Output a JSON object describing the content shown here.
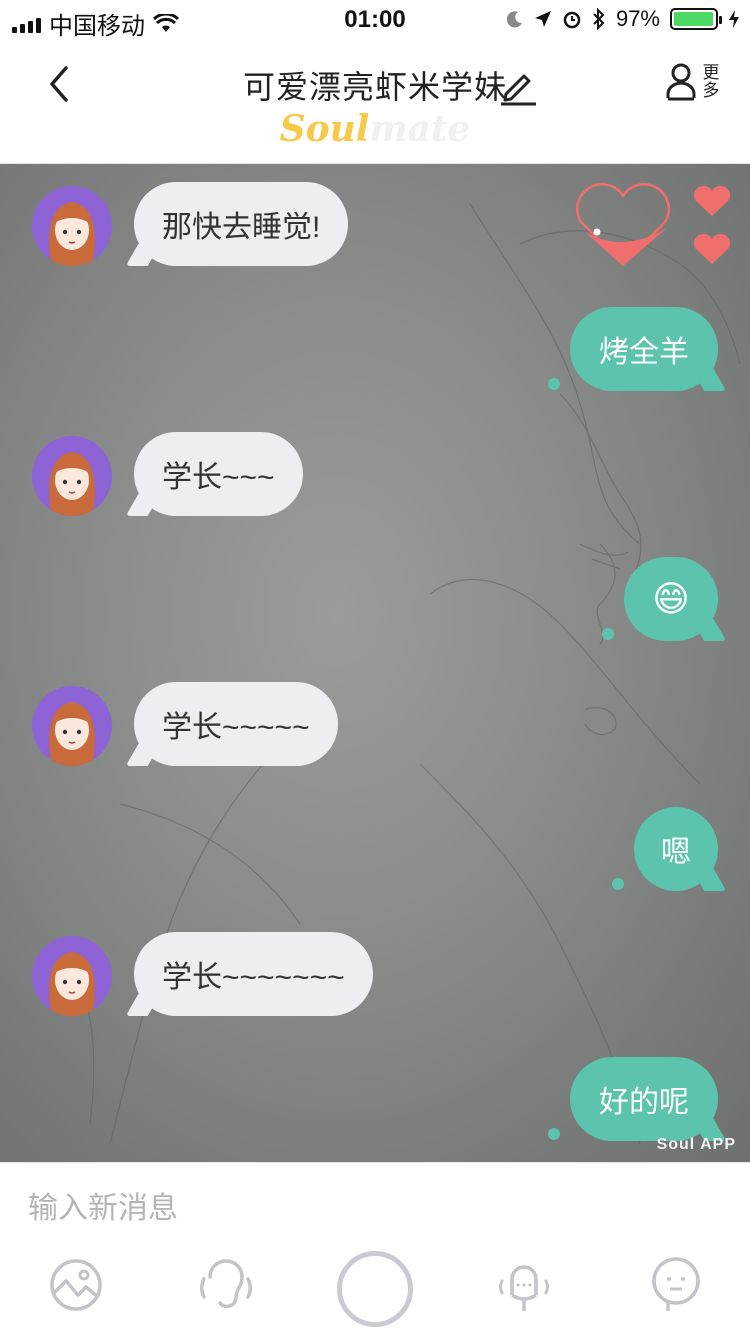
{
  "status_bar": {
    "carrier": "中国移动",
    "time": "01:00",
    "battery_percent": "97%",
    "battery_level": 0.97
  },
  "header": {
    "title": "可爱漂亮虾米学妹",
    "more_label": "更多",
    "more_label_line1": "更",
    "more_label_line2": "多",
    "brand_soul": "Soul",
    "brand_mate": "mate"
  },
  "chat": {
    "messages": [
      {
        "side": "in",
        "text": "那快去睡觉!"
      },
      {
        "side": "out",
        "text": "烤全羊"
      },
      {
        "side": "in",
        "text": "学长~~~"
      },
      {
        "side": "out",
        "text": "😄"
      },
      {
        "side": "in",
        "text": "学长~~~~~"
      },
      {
        "side": "out",
        "text": "嗯"
      },
      {
        "side": "in",
        "text": "学长~~~~~~~"
      },
      {
        "side": "out",
        "text": "好的呢"
      }
    ],
    "watermark": "Soul APP"
  },
  "input": {
    "placeholder": "输入新消息"
  },
  "colors": {
    "accent_green": "#5cc4ac",
    "incoming_bubble": "#eceef1",
    "brand_yellow": "#f6c94a",
    "heart_red": "#ef6f6c",
    "avatar_purple": "#8d63d6"
  },
  "icons": [
    "back-icon",
    "edit-icon",
    "user-icon",
    "heart-icon",
    "image-icon",
    "voice-icon",
    "mic-icon",
    "emoji-icon"
  ]
}
